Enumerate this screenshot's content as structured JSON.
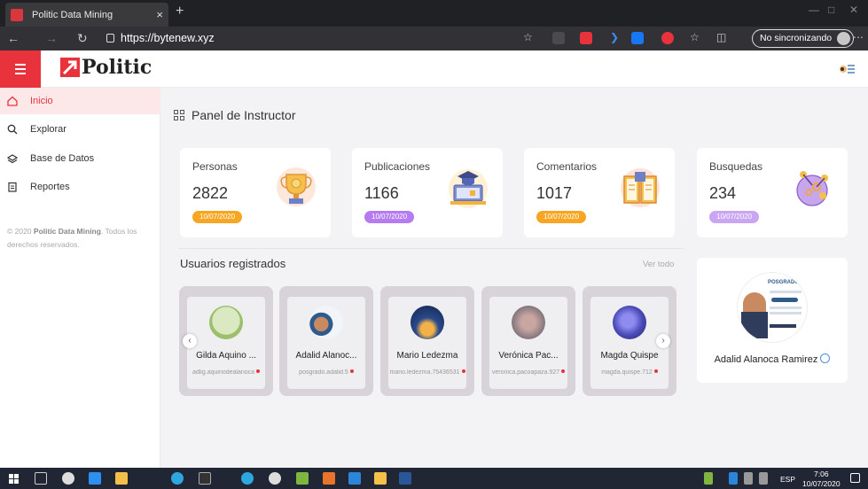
{
  "browser": {
    "tab_title": "Politic Data Mining",
    "tab_close": "×",
    "new_tab": "+",
    "url": "https://bytenew.xyz",
    "sync_label": "No sincronizando"
  },
  "app": {
    "brand": "Politic",
    "brand_color": "#e8323c"
  },
  "sidebar": {
    "items": [
      {
        "label": "Inicio",
        "icon": "home-icon",
        "active": true
      },
      {
        "label": "Explorar",
        "icon": "search-icon"
      },
      {
        "label": "Base de Datos",
        "icon": "layers-icon"
      },
      {
        "label": "Reportes",
        "icon": "report-icon"
      }
    ],
    "copyright_prefix": "© 2020 ",
    "copyright_brand": "Politic Data Mining",
    "copyright_suffix": ". Todos los derechos reservados."
  },
  "panel": {
    "title": "Panel de Instructor"
  },
  "stats": [
    {
      "label": "Personas",
      "value": "2822",
      "date": "10/07/2020",
      "badge_color": "#f6a623",
      "icon": "trophy-icon"
    },
    {
      "label": "Publicaciones",
      "value": "1166",
      "date": "10/07/2020",
      "badge_color": "#b57cf0",
      "icon": "graduation-laptop-icon"
    },
    {
      "label": "Comentarios",
      "value": "1017",
      "date": "10/07/2020",
      "badge_color": "#f6a623",
      "icon": "book-icon"
    },
    {
      "label": "Busquedas",
      "value": "234",
      "date": "10/07/2020",
      "badge_color": "#c9a5f2",
      "icon": "molecule-icon"
    }
  ],
  "users": {
    "title": "Usuarios registrados",
    "see_all": "Ver todo",
    "list": [
      {
        "name": "Gilda Aquino ...",
        "handle": "adlig.aquinodealanoca"
      },
      {
        "name": "Adalid Alanoc...",
        "handle": "posgrado.adalid.5"
      },
      {
        "name": "Mario Ledezma",
        "handle": "mario.ledezma.75436531"
      },
      {
        "name": "Verónica Pac...",
        "handle": "veronica.pacoapaza.927"
      },
      {
        "name": "Magda Quispe",
        "handle": "magda.quispe.712"
      }
    ]
  },
  "profile": {
    "name": "Adalid Alanoca Ramirez",
    "poster_text": "POSGRADO"
  },
  "taskbar": {
    "lang": "ESP",
    "time": "7:06",
    "date": "10/07/2020"
  }
}
